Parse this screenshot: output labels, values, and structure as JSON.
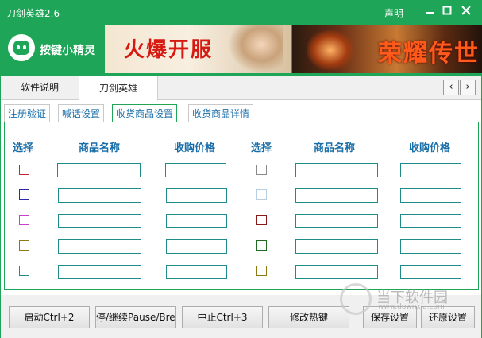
{
  "window": {
    "title": "刀剑英雄2.6",
    "declare": "声明"
  },
  "banner": {
    "brand": "按键小精灵",
    "ad1_text": "火爆开服",
    "ad2_text": "荣耀传世"
  },
  "top_tabs": [
    "软件说明",
    "刀剑英雄"
  ],
  "sub_tabs": [
    "注册验证",
    "喊话设置",
    "收货商品设置",
    "收货商品详情"
  ],
  "headers": {
    "select": "选择",
    "name": "商品名称",
    "price": "收购价格"
  },
  "checkbox_colors_left": [
    "#c0282d",
    "#2b2ba5",
    "#c83cc8",
    "#8a7a10",
    "#1f8a8a"
  ],
  "checkbox_colors_right": [
    "#8a8a8a",
    "#b8cde0",
    "#8a1a1a",
    "#1e6a1e",
    "#8a7a10"
  ],
  "buttons": [
    "启动Ctrl+2",
    "停/继续Pause/Break",
    "中止Ctrl+3",
    "修改热键",
    "保存设置",
    "还原设置"
  ],
  "watermark": {
    "text": "当下软件园",
    "sub": "www.downxia.com"
  },
  "icons": {
    "minimize": "minimize-icon",
    "maximize": "maximize-icon",
    "close": "close-icon",
    "prev": "chevron-left-icon",
    "next": "chevron-right-icon"
  }
}
